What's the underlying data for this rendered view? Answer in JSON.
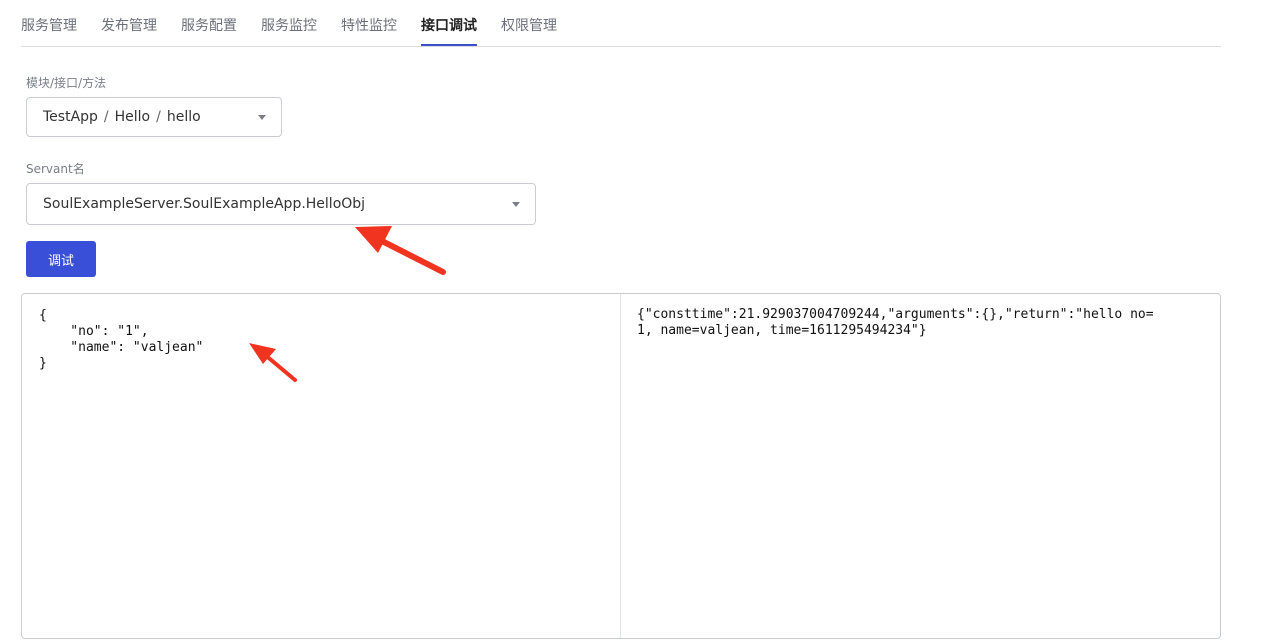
{
  "tabs": [
    {
      "label": "服务管理",
      "active": false
    },
    {
      "label": "发布管理",
      "active": false
    },
    {
      "label": "服务配置",
      "active": false
    },
    {
      "label": "服务监控",
      "active": false
    },
    {
      "label": "特性监控",
      "active": false
    },
    {
      "label": "接口调试",
      "active": true
    },
    {
      "label": "权限管理",
      "active": false
    }
  ],
  "form": {
    "module_label": "模块/接口/方法",
    "module_path": [
      "TestApp",
      "Hello",
      "hello"
    ],
    "path_separator": "/",
    "servant_label": "Servant名",
    "servant_value": "SoulExampleServer.SoulExampleApp.HelloObj",
    "debug_button": "调试"
  },
  "editor": {
    "request": "{\n    \"no\": \"1\",\n    \"name\": \"valjean\"\n}",
    "response": "{\"consttime\":21.929037004709244,\"arguments\":{},\"return\":\"hello no=1, name=valjean, time=1611295494234\"}"
  },
  "colors": {
    "accent": "#3a4fd8",
    "arrow": "#f0341f"
  },
  "icons": {
    "select_caret": "caret-down-icon",
    "annotation": "red-arrow-icon"
  }
}
